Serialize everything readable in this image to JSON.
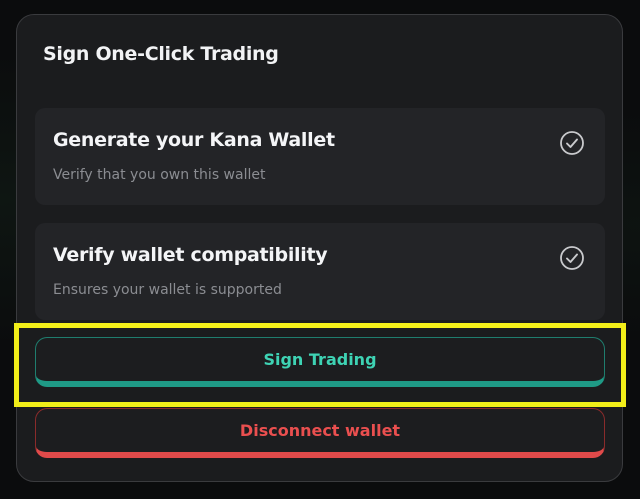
{
  "modal": {
    "title": "Sign One-Click Trading"
  },
  "steps": [
    {
      "title": "Generate your Kana Wallet",
      "subtitle": "Verify that you own this wallet",
      "status_icon": "check-circle-icon"
    },
    {
      "title": "Verify wallet compatibility",
      "subtitle": "Ensures your wallet is supported",
      "status_icon": "check-circle-icon"
    }
  ],
  "actions": {
    "sign_label": "Sign Trading",
    "disconnect_label": "Disconnect wallet"
  },
  "colors": {
    "accent_teal": "#3ed3b4",
    "danger_red": "#ea4f4f",
    "highlight": "#f2ee19",
    "panel": "#1b1c1e"
  }
}
